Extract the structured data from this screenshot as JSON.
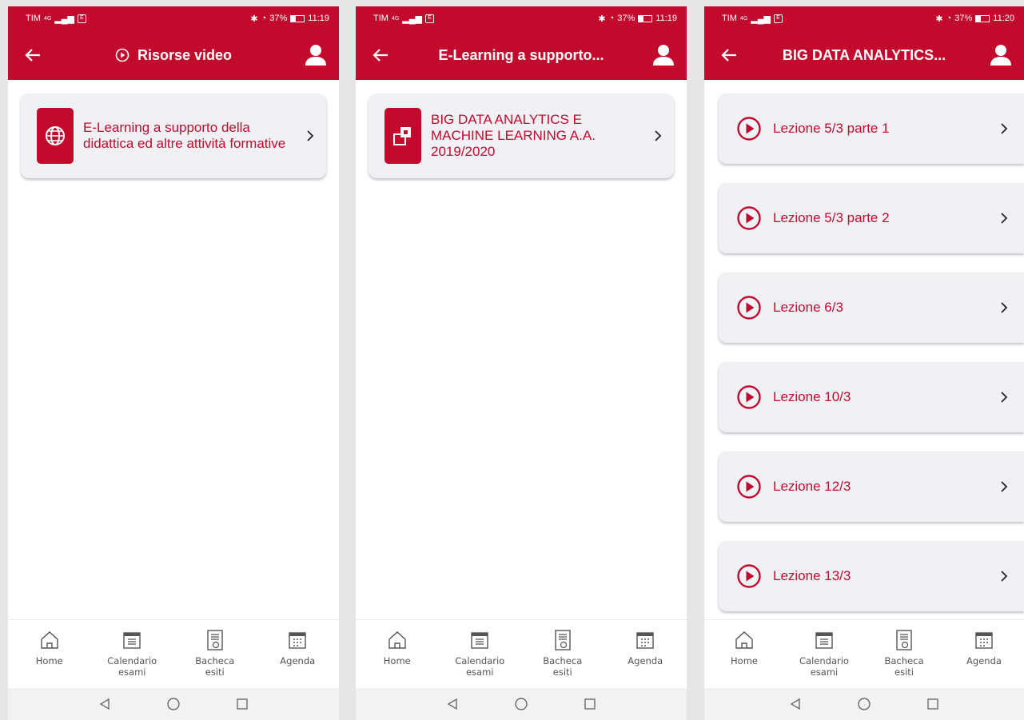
{
  "colors": {
    "brand_red": "#c20a2d",
    "card_bg": "#f1f1f5",
    "nav_gray": "#555555"
  },
  "bottom_nav": [
    {
      "label": "Home",
      "icon": "home-icon"
    },
    {
      "label": "Calendario\nesami",
      "icon": "calendar-list-icon"
    },
    {
      "label": "Bacheca\nesiti",
      "icon": "results-board-icon"
    },
    {
      "label": "Agenda",
      "icon": "agenda-icon"
    }
  ],
  "screens": [
    {
      "status": {
        "carrier": "TIM",
        "network": "4G",
        "sim": "E",
        "battery_percent": "37%",
        "time": "11:19"
      },
      "title": "Risorse video",
      "title_icon": "play-circle-icon",
      "cards": [
        {
          "label": "E-Learning a supporto della didattica ed altre attività formative",
          "icon": "globe-icon"
        }
      ]
    },
    {
      "status": {
        "carrier": "TIM",
        "network": "4G",
        "sim": "E",
        "battery_percent": "37%",
        "time": "11:19"
      },
      "title": "E-Learning a supporto...",
      "cards": [
        {
          "label": "BIG DATA ANALYTICS E MACHINE LEARNING A.A. 2019/2020",
          "icon": "folder-module-icon"
        }
      ]
    },
    {
      "status": {
        "carrier": "TIM",
        "network": "4G",
        "sim": "E",
        "battery_percent": "37%",
        "time": "11:20"
      },
      "title": "BIG DATA ANALYTICS...",
      "lessons": [
        {
          "label": "Lezione 5/3 parte 1"
        },
        {
          "label": "Lezione 5/3 parte 2"
        },
        {
          "label": "Lezione 6/3"
        },
        {
          "label": "Lezione 10/3"
        },
        {
          "label": "Lezione 12/3"
        },
        {
          "label": "Lezione 13/3"
        }
      ]
    }
  ]
}
